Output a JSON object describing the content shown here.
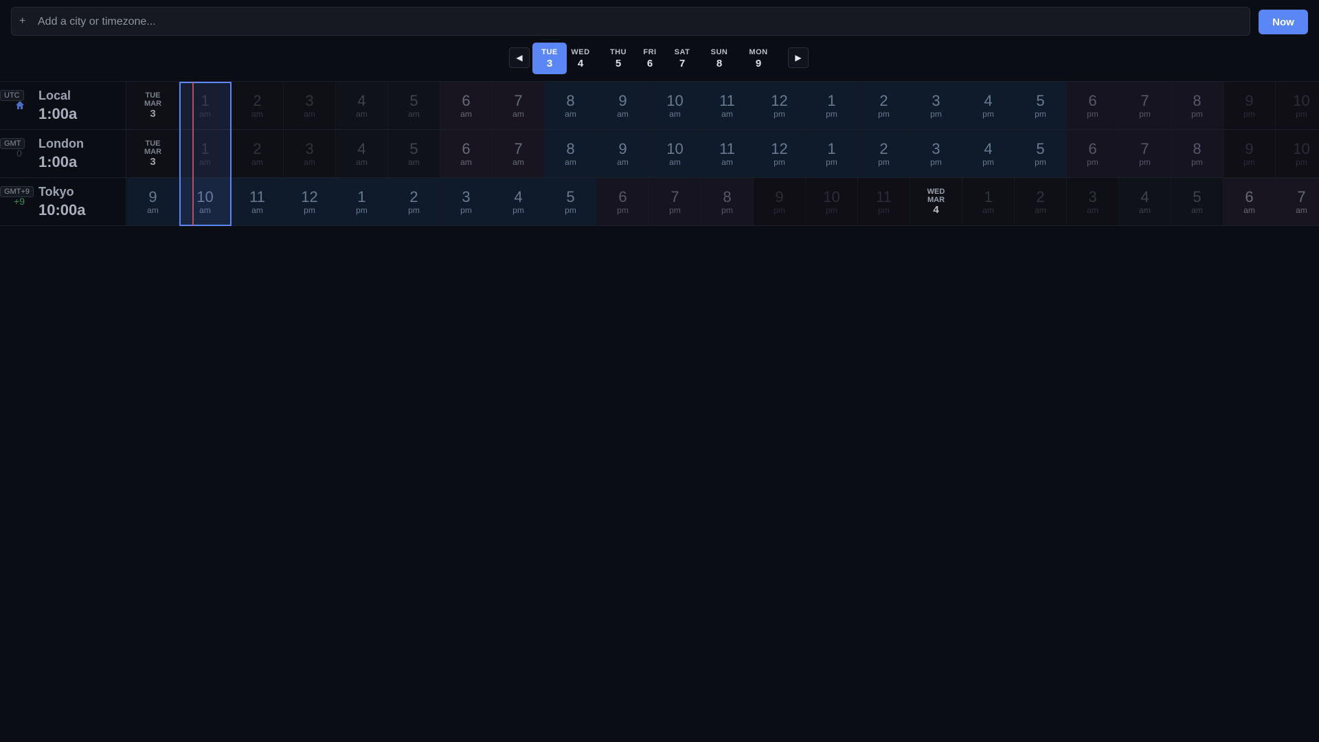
{
  "search": {
    "plus_icon": "+",
    "placeholder": "Add a city or timezone...",
    "value": ""
  },
  "now_button": {
    "label": "Now"
  },
  "day_nav": {
    "prev_icon": "◀",
    "next_icon": "▶",
    "days": [
      {
        "name": "TUE",
        "date": "3",
        "active": true
      },
      {
        "name": "WED",
        "date": "4"
      },
      {
        "name": "THU",
        "date": "5"
      },
      {
        "name": "FRI",
        "date": "6"
      },
      {
        "name": "SAT",
        "date": "7"
      },
      {
        "name": "SUN",
        "date": "8"
      },
      {
        "name": "MON",
        "date": "9"
      }
    ]
  },
  "accent_color": "#5b86f6",
  "now_line_color": "#d9546a",
  "rows": [
    {
      "offset": "",
      "home_icon": "home-icon",
      "city": "Local",
      "tz": "UTC",
      "time": "1:00a",
      "cells": [
        {
          "k": "date",
          "dn": "TUE",
          "dm": "MAR",
          "dd": "3"
        },
        {
          "k": "night",
          "h": "1",
          "m": "am"
        },
        {
          "k": "night",
          "h": "2",
          "m": "am"
        },
        {
          "k": "night",
          "h": "3",
          "m": "am"
        },
        {
          "k": "dawn",
          "h": "4",
          "m": "am"
        },
        {
          "k": "dawn",
          "h": "5",
          "m": "am"
        },
        {
          "k": "morn",
          "h": "6",
          "m": "am"
        },
        {
          "k": "morn",
          "h": "7",
          "m": "am"
        },
        {
          "k": "work",
          "h": "8",
          "m": "am"
        },
        {
          "k": "work",
          "h": "9",
          "m": "am"
        },
        {
          "k": "work",
          "h": "10",
          "m": "am"
        },
        {
          "k": "work",
          "h": "11",
          "m": "am"
        },
        {
          "k": "work",
          "h": "12",
          "m": "pm"
        },
        {
          "k": "work",
          "h": "1",
          "m": "pm"
        },
        {
          "k": "work",
          "h": "2",
          "m": "pm"
        },
        {
          "k": "work",
          "h": "3",
          "m": "pm"
        },
        {
          "k": "work",
          "h": "4",
          "m": "pm"
        },
        {
          "k": "work",
          "h": "5",
          "m": "pm"
        },
        {
          "k": "eve",
          "h": "6",
          "m": "pm"
        },
        {
          "k": "eve",
          "h": "7",
          "m": "pm"
        },
        {
          "k": "eve",
          "h": "8",
          "m": "pm"
        },
        {
          "k": "late",
          "h": "9",
          "m": "pm"
        },
        {
          "k": "late",
          "h": "10",
          "m": "pm"
        }
      ]
    },
    {
      "offset": "0",
      "city": "London",
      "tz": "GMT",
      "time": "1:00a",
      "cells": [
        {
          "k": "date",
          "dn": "TUE",
          "dm": "MAR",
          "dd": "3"
        },
        {
          "k": "night",
          "h": "1",
          "m": "am"
        },
        {
          "k": "night",
          "h": "2",
          "m": "am"
        },
        {
          "k": "night",
          "h": "3",
          "m": "am"
        },
        {
          "k": "dawn",
          "h": "4",
          "m": "am"
        },
        {
          "k": "dawn",
          "h": "5",
          "m": "am"
        },
        {
          "k": "morn",
          "h": "6",
          "m": "am"
        },
        {
          "k": "morn",
          "h": "7",
          "m": "am"
        },
        {
          "k": "work",
          "h": "8",
          "m": "am"
        },
        {
          "k": "work",
          "h": "9",
          "m": "am"
        },
        {
          "k": "work",
          "h": "10",
          "m": "am"
        },
        {
          "k": "work",
          "h": "11",
          "m": "am"
        },
        {
          "k": "work",
          "h": "12",
          "m": "pm"
        },
        {
          "k": "work",
          "h": "1",
          "m": "pm"
        },
        {
          "k": "work",
          "h": "2",
          "m": "pm"
        },
        {
          "k": "work",
          "h": "3",
          "m": "pm"
        },
        {
          "k": "work",
          "h": "4",
          "m": "pm"
        },
        {
          "k": "work",
          "h": "5",
          "m": "pm"
        },
        {
          "k": "eve",
          "h": "6",
          "m": "pm"
        },
        {
          "k": "eve",
          "h": "7",
          "m": "pm"
        },
        {
          "k": "eve",
          "h": "8",
          "m": "pm"
        },
        {
          "k": "late",
          "h": "9",
          "m": "pm"
        },
        {
          "k": "late",
          "h": "10",
          "m": "pm"
        }
      ]
    },
    {
      "offset": "+9",
      "city": "Tokyo",
      "tz": "GMT+9",
      "time": "10:00a",
      "cells": [
        {
          "k": "work",
          "h": "9",
          "m": "am"
        },
        {
          "k": "work",
          "h": "10",
          "m": "am"
        },
        {
          "k": "work",
          "h": "11",
          "m": "am"
        },
        {
          "k": "work",
          "h": "12",
          "m": "pm"
        },
        {
          "k": "work",
          "h": "1",
          "m": "pm"
        },
        {
          "k": "work",
          "h": "2",
          "m": "pm"
        },
        {
          "k": "work",
          "h": "3",
          "m": "pm"
        },
        {
          "k": "work",
          "h": "4",
          "m": "pm"
        },
        {
          "k": "work",
          "h": "5",
          "m": "pm"
        },
        {
          "k": "eve",
          "h": "6",
          "m": "pm"
        },
        {
          "k": "eve",
          "h": "7",
          "m": "pm"
        },
        {
          "k": "eve",
          "h": "8",
          "m": "pm"
        },
        {
          "k": "late",
          "h": "9",
          "m": "pm"
        },
        {
          "k": "late",
          "h": "10",
          "m": "pm"
        },
        {
          "k": "late",
          "h": "11",
          "m": "pm"
        },
        {
          "k": "date",
          "dn": "WED",
          "dm": "MAR",
          "dd": "4"
        },
        {
          "k": "night",
          "h": "1",
          "m": "am"
        },
        {
          "k": "night",
          "h": "2",
          "m": "am"
        },
        {
          "k": "night",
          "h": "3",
          "m": "am"
        },
        {
          "k": "dawn",
          "h": "4",
          "m": "am"
        },
        {
          "k": "dawn",
          "h": "5",
          "m": "am"
        },
        {
          "k": "morn",
          "h": "6",
          "m": "am"
        },
        {
          "k": "morn",
          "h": "7",
          "m": "am"
        }
      ]
    }
  ]
}
